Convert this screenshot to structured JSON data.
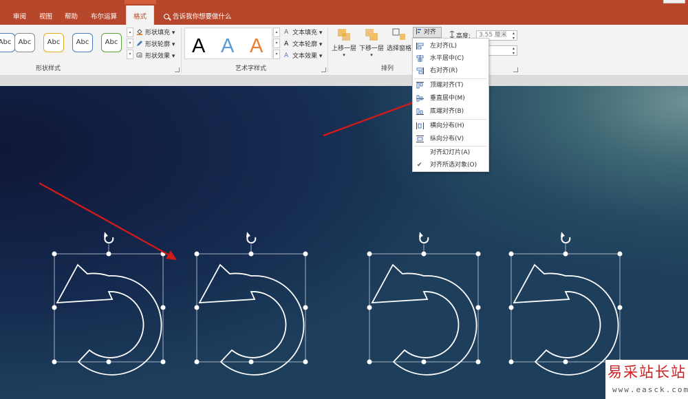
{
  "ribbon_tabs": {
    "review": "审阅",
    "view": "视图",
    "help": "帮助",
    "boolean": "布尔运算",
    "format": "格式",
    "tell_me": "告诉我你想要做什么"
  },
  "shape_styles": {
    "gallery": [
      {
        "label": "Abc",
        "border": "#4a78c2"
      },
      {
        "label": "Abc",
        "border": "#8a8a8a"
      },
      {
        "label": "Abc",
        "border": "#e3a91f"
      },
      {
        "label": "Abc",
        "border": "#4a78c2"
      },
      {
        "label": "Abc",
        "border": "#5aa332"
      }
    ],
    "fill": "形状填充",
    "outline": "形状轮廓",
    "effects": "形状效果",
    "group_label": "形状样式"
  },
  "wordart_styles": {
    "samples": [
      {
        "glyph": "A",
        "color": "#000000"
      },
      {
        "glyph": "A",
        "color": "#5b9bd5"
      },
      {
        "glyph": "A",
        "color": "#ed7d31"
      }
    ],
    "text_fill": "文本填充",
    "text_outline": "文本轮廓",
    "text_effects": "文本效果",
    "group_label": "艺术字样式"
  },
  "arrange": {
    "bring_forward": "上移一层",
    "send_backward": "下移一层",
    "selection_pane": "选择窗格",
    "align": "对齐",
    "group_label": "排列"
  },
  "size": {
    "height_label": "高度:",
    "height_value": "3.55 厘米"
  },
  "align_menu": {
    "items": [
      {
        "label": "左对齐(L)",
        "icon": "align-left-icon"
      },
      {
        "label": "水平居中(C)",
        "icon": "align-center-icon"
      },
      {
        "label": "右对齐(R)",
        "icon": "align-right-icon"
      },
      {
        "label": "顶端对齐(T)",
        "icon": "align-top-icon"
      },
      {
        "label": "垂直居中(M)",
        "icon": "align-middle-icon"
      },
      {
        "label": "底端对齐(B)",
        "icon": "align-bottom-icon"
      },
      {
        "label": "横向分布(H)",
        "icon": "distribute-horizontal-icon"
      },
      {
        "label": "纵向分布(V)",
        "icon": "distribute-vertical-icon"
      },
      {
        "label": "对齐幻灯片(A)",
        "icon": ""
      },
      {
        "label": "对齐所选对象(O)",
        "icon": "check-icon",
        "checked": true
      }
    ]
  },
  "watermark": {
    "chinese": "易采站长站",
    "url": "www.easck.com"
  },
  "colors": {
    "ribbon_accent": "#b7472a",
    "annotation_arrow": "#d11a1a"
  }
}
